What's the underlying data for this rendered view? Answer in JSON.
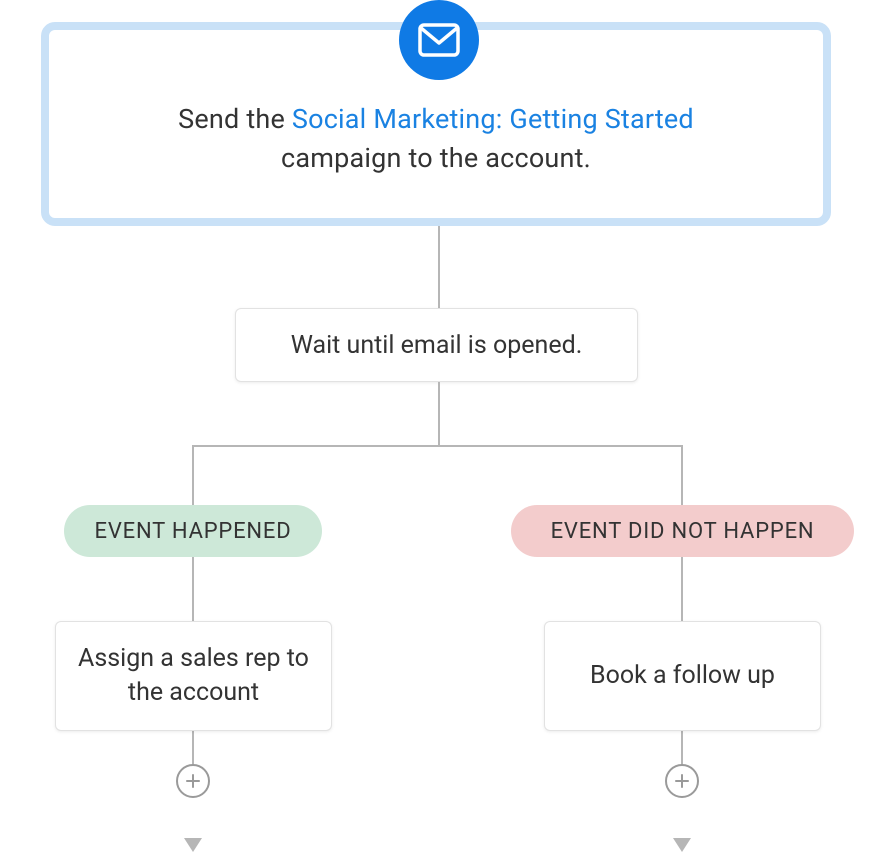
{
  "email_badge_icon": "mail-icon",
  "main_card": {
    "text_before": "Send the ",
    "link_text": "Social Marketing: Getting Started",
    "text_after": " campaign to the account."
  },
  "wait_card": {
    "text": "Wait until email is opened."
  },
  "branches": {
    "left": {
      "pill_label": "EVENT HAPPENED",
      "action_text": "Assign a sales rep to the account"
    },
    "right": {
      "pill_label": "EVENT DID NOT HAPPEN",
      "action_text": "Book a follow up"
    }
  },
  "colors": {
    "accent_blue": "#0f7ae5",
    "card_border_blue": "#c9e1f7",
    "link_blue": "#1a82e2",
    "pill_green": "#cde8d8",
    "pill_red": "#f3cccc",
    "connector_grey": "#b6b6b6"
  }
}
